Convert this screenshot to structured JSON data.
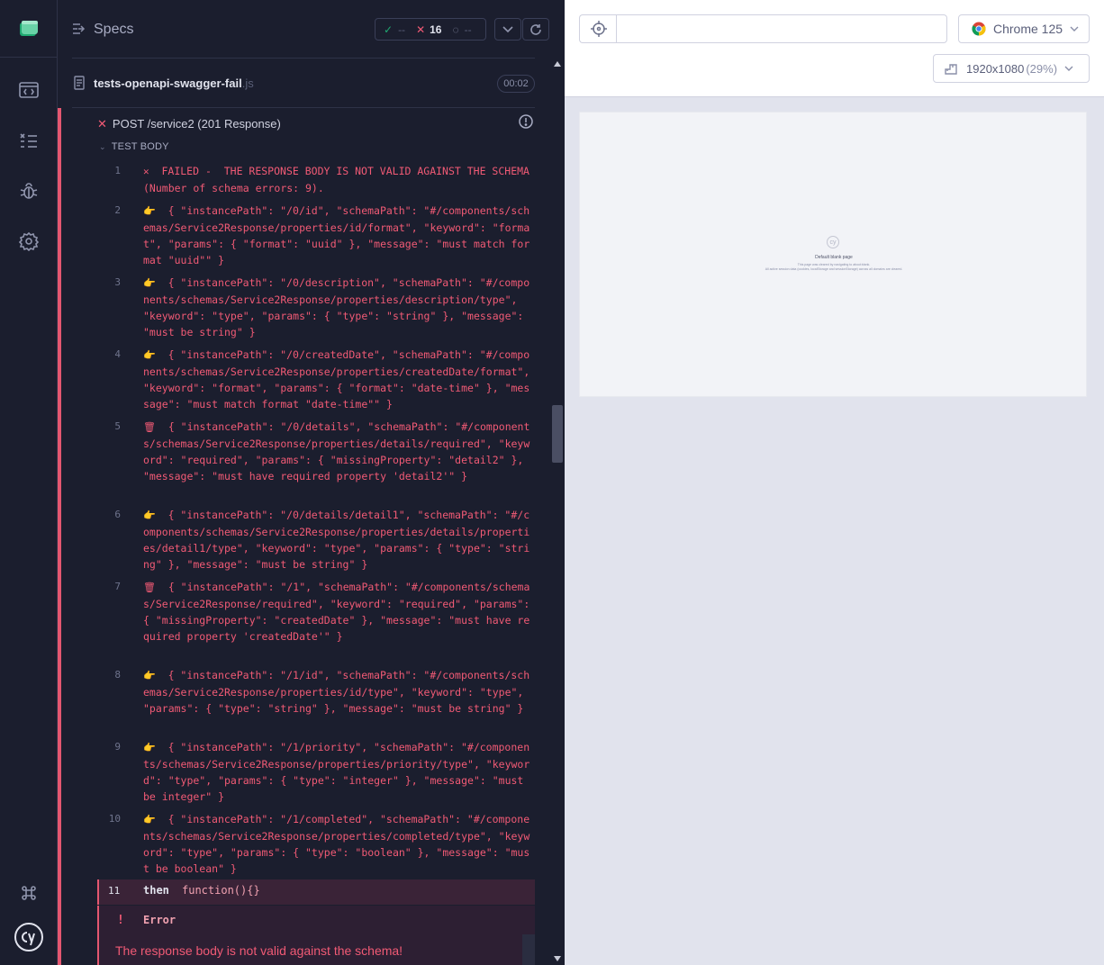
{
  "reporter": {
    "header": {
      "specs_label": "Specs",
      "passed": "--",
      "failed": "16",
      "pending": "--"
    },
    "spec": {
      "name": "tests-openapi-swagger-fail",
      "ext": ".js",
      "duration": "00:02"
    },
    "test": {
      "title": "POST /service2 (201 Response)",
      "section_label": "TEST BODY"
    },
    "commands": [
      {
        "num": "1",
        "text": "FAILED -  THE RESPONSE BODY IS NOT VALID AGAINST THE SCHEMA (Number of schema errors: 9).",
        "icon": "x"
      },
      {
        "num": "2",
        "text": "{ \"instancePath\": \"/0/id\", \"schemaPath\": \"#/components/schemas/Service2Response/properties/id/format\", \"keyword\": \"format\", \"params\": { \"format\": \"uuid\" }, \"message\": \"must match format \"uuid\"\" }",
        "icon": "👉"
      },
      {
        "num": "3",
        "text": "{ \"instancePath\": \"/0/description\", \"schemaPath\": \"#/components/schemas/Service2Response/properties/description/type\", \"keyword\": \"type\", \"params\": { \"type\": \"string\" }, \"message\": \"must be string\" }",
        "icon": "👉"
      },
      {
        "num": "4",
        "text": "{ \"instancePath\": \"/0/createdDate\", \"schemaPath\": \"#/components/schemas/Service2Response/properties/createdDate/format\", \"keyword\": \"format\", \"params\": { \"format\": \"date-time\" }, \"message\": \"must match format \"date-time\"\" }",
        "icon": "👉"
      },
      {
        "num": "5",
        "text": "{ \"instancePath\": \"/0/details\", \"schemaPath\": \"#/components/schemas/Service2Response/properties/details/required\", \"keyword\": \"required\", \"params\": { \"missingProperty\": \"detail2\" }, \"message\": \"must have required property 'detail2'\" }",
        "icon": "🗑"
      },
      {
        "num": "6",
        "text": "{ \"instancePath\": \"/0/details/detail1\", \"schemaPath\": \"#/components/schemas/Service2Response/properties/details/properties/detail1/type\", \"keyword\": \"type\", \"params\": { \"type\": \"string\" }, \"message\": \"must be string\" }",
        "icon": "👉"
      },
      {
        "num": "7",
        "text": "{ \"instancePath\": \"/1\", \"schemaPath\": \"#/components/schemas/Service2Response/required\", \"keyword\": \"required\", \"params\": { \"missingProperty\": \"createdDate\" }, \"message\": \"must have required property 'createdDate'\" }",
        "icon": "🗑"
      },
      {
        "num": "8",
        "text": "{ \"instancePath\": \"/1/id\", \"schemaPath\": \"#/components/schemas/Service2Response/properties/id/type\", \"keyword\": \"type\", \"params\": { \"type\": \"string\" }, \"message\": \"must be string\" }",
        "icon": "👉"
      },
      {
        "num": "9",
        "text": "{ \"instancePath\": \"/1/priority\", \"schemaPath\": \"#/components/schemas/Service2Response/properties/priority/type\", \"keyword\": \"type\", \"params\": { \"type\": \"integer\" }, \"message\": \"must be integer\" }",
        "icon": "👉"
      },
      {
        "num": "10",
        "text": "{ \"instancePath\": \"/1/completed\", \"schemaPath\": \"#/components/schemas/Service2Response/properties/completed/type\", \"keyword\": \"type\", \"params\": { \"type\": \"boolean\" }, \"message\": \"must be boolean\" }",
        "icon": "👉"
      }
    ],
    "then_row": {
      "num": "11",
      "keyword": "then",
      "fn": "function(){}"
    },
    "error": {
      "bang": "!",
      "label": "Error",
      "message": "The response body is not valid against the schema!"
    }
  },
  "aut": {
    "url": "",
    "browser": "Chrome 125",
    "viewport": "1920x1080",
    "zoom": "(29%)",
    "blank": {
      "logo": "cy",
      "title": "Default blank page",
      "sub1": "This page was cleared by navigating to about:blank.",
      "sub2": "All active session data (cookies, localStorage and sessionStorage) across all domains are cleared."
    }
  },
  "colors": {
    "fail": "#f15a75",
    "pass": "#1fa971",
    "accent": "#e45770"
  }
}
